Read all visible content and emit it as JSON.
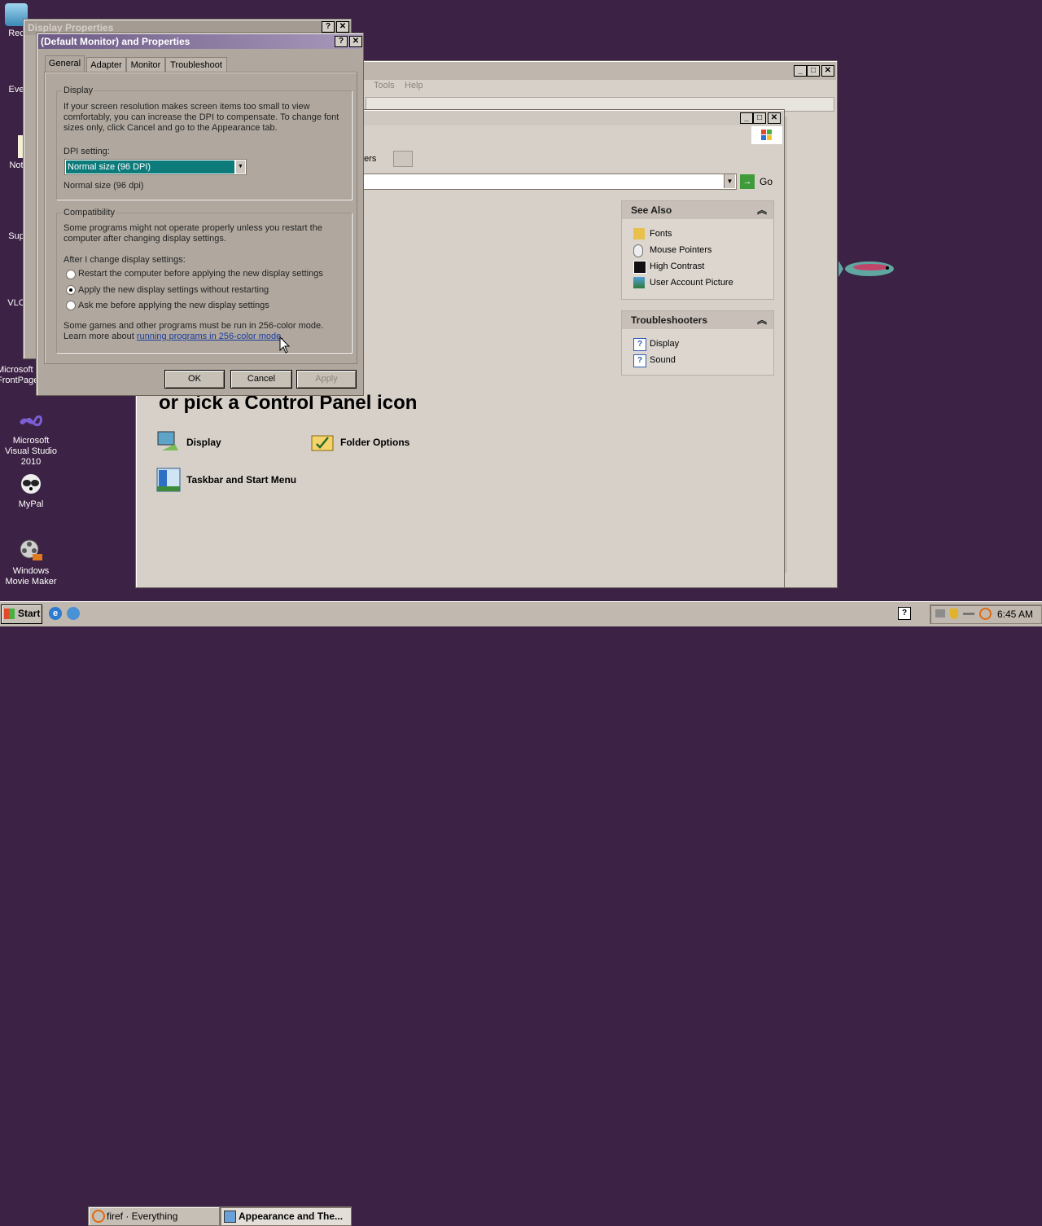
{
  "desktop": {
    "icons": [
      {
        "label": "Rec",
        "icon": "recycle-bin-icon"
      },
      {
        "label": "Eve",
        "icon": "everything-icon"
      },
      {
        "label": "Not",
        "icon": "notepad-icon"
      },
      {
        "label": "Sup",
        "icon": "support-icon"
      },
      {
        "label": "VLC",
        "icon": "vlc-icon"
      },
      {
        "label": "Microsoft FrontPage",
        "icon": "frontpage-icon"
      },
      {
        "label": "Microsoft Visual Studio 2010",
        "icon": "visual-studio-icon"
      },
      {
        "label": "MyPal",
        "icon": "mypal-icon"
      },
      {
        "label": "Windows Movie Maker",
        "icon": "movie-maker-icon"
      }
    ]
  },
  "bg_window": {
    "title": "Display Properties"
  },
  "dialog": {
    "title": "(Default Monitor) and  Properties",
    "help_btn": "?",
    "close_btn": "✕",
    "tabs": [
      "General",
      "Adapter",
      "Monitor",
      "Troubleshoot"
    ],
    "display_group": {
      "legend": "Display",
      "text": "If your screen resolution makes screen items too small to view comfortably, you can increase the DPI to compensate.  To change font sizes only, click Cancel and go to the Appearance tab.",
      "dpi_label": "DPI setting:",
      "dpi_value": "Normal size (96 DPI)",
      "dpi_note": "Normal size (96 dpi)"
    },
    "compat_group": {
      "legend": "Compatibility",
      "text": "Some programs might not operate properly unless you restart the computer after changing display settings.",
      "after_label": "After I change display settings:",
      "options": [
        {
          "label": "Restart the computer before applying the new display settings",
          "checked": false
        },
        {
          "label": "Apply the new display settings without restarting",
          "checked": true
        },
        {
          "label": "Ask me before applying the new display settings",
          "checked": false
        }
      ],
      "games_text": "Some games and other programs must be run in 256-color mode.",
      "learn_prefix": "Learn more about ",
      "learn_link": "running programs in 256-color mode",
      "learn_suffix": "."
    },
    "buttons": {
      "ok": "OK",
      "cancel": "Cancel",
      "apply": "Apply"
    }
  },
  "explorer": {
    "menu": [
      "Tools",
      "Help"
    ],
    "toolbar_folders": "ders",
    "go_label": "Go",
    "heading": "or pick a Control Panel icon",
    "icons": [
      {
        "label": "Display",
        "icon": "display-icon"
      },
      {
        "label": "Folder Options",
        "icon": "folder-options-icon"
      },
      {
        "label": "Taskbar and Start Menu",
        "icon": "taskbar-icon"
      }
    ],
    "see_also": {
      "title": "See Also",
      "items": [
        {
          "label": "Fonts",
          "icon": "fonts-folder-icon"
        },
        {
          "label": "Mouse Pointers",
          "icon": "mouse-icon"
        },
        {
          "label": "High Contrast",
          "icon": "contrast-icon"
        },
        {
          "label": "User Account Picture",
          "icon": "user-picture-icon"
        }
      ]
    },
    "troubleshooters": {
      "title": "Troubleshooters",
      "items": [
        {
          "label": "Display",
          "icon": "help-icon"
        },
        {
          "label": "Sound",
          "icon": "help-icon"
        }
      ]
    }
  },
  "taskbar": {
    "start": "Start",
    "tasks": [
      {
        "label": "firef · Everything",
        "active": false
      },
      {
        "label": "Appearance and The...",
        "active": true
      }
    ],
    "clock": "6:45 AM"
  },
  "colors": {
    "desktop": "#3c2244",
    "dialog_title": "#6d5b86",
    "selection": "#0e7b7b",
    "link": "#1a3d9e"
  }
}
